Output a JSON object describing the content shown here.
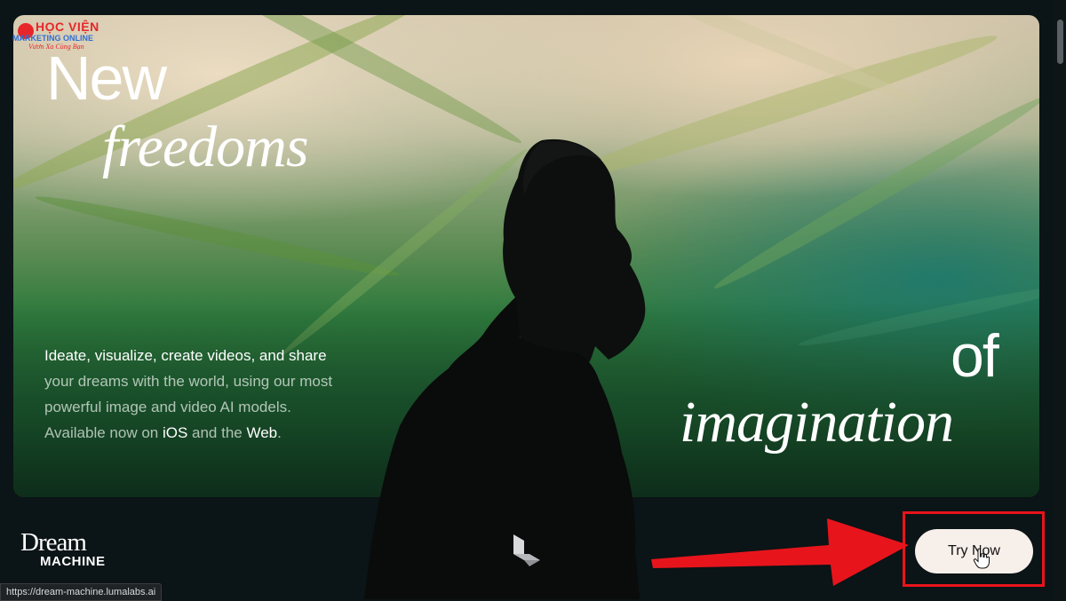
{
  "watermark": {
    "line1": "HỌC VIỆN",
    "line2": "MARKETING ONLINE",
    "line3": "Vươn Xa Cùng Bạn"
  },
  "hero": {
    "title_new": "New",
    "title_freedoms": "freedoms",
    "title_of": "of",
    "title_imagination": "imagination",
    "description": {
      "part1": "Ideate, visualize, create videos, and share",
      "part2": " your dreams with the world, using our most powerful image and video AI models. Available now on ",
      "part3": "iOS",
      "part4": " and the ",
      "part5": "Web",
      "part6": "."
    }
  },
  "brand": {
    "dream": "Dream",
    "machine": "MACHINE"
  },
  "cta": {
    "label": "Try Now"
  },
  "status_bar": {
    "url": "https://dream-machine.lumalabs.ai"
  },
  "colors": {
    "highlight": "#e8141c",
    "button_bg": "#f7efea",
    "page_bg": "#0b1416"
  },
  "icons": [
    "luma-logo-icon",
    "red-arrow-icon",
    "hand-cursor-icon"
  ]
}
